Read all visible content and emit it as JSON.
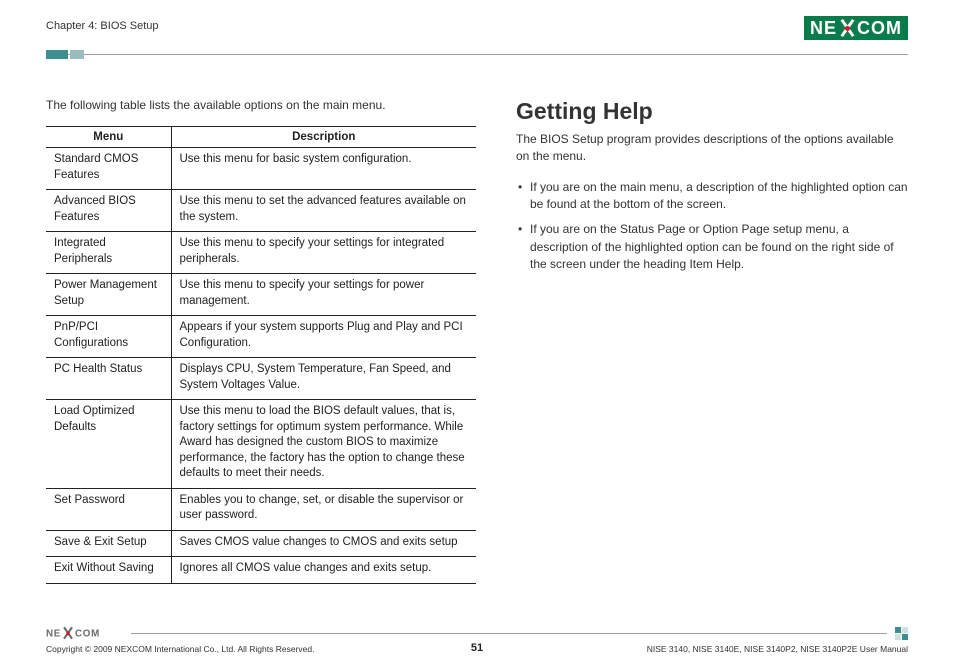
{
  "header": {
    "chapter": "Chapter 4: BIOS Setup",
    "logo_text_left": "NE",
    "logo_text_right": "COM"
  },
  "left": {
    "intro": "The following table lists the available options on the main menu.",
    "th_menu": "Menu",
    "th_desc": "Description",
    "rows": [
      {
        "menu": "Standard CMOS Features",
        "desc": "Use this menu for basic system configuration."
      },
      {
        "menu": "Advanced BIOS Features",
        "desc": "Use this menu to set the advanced features available on the system."
      },
      {
        "menu": "Integrated Peripherals",
        "desc": "Use this menu to specify your settings for integrated peripherals."
      },
      {
        "menu": "Power Management Setup",
        "desc": "Use this menu to specify your settings for power management."
      },
      {
        "menu": "PnP/PCI Configurations",
        "desc": "Appears if your system supports Plug and Play and PCI Configuration."
      },
      {
        "menu": "PC Health Status",
        "desc": "Displays CPU, System Temperature, Fan Speed, and System Voltages Value."
      },
      {
        "menu": "Load Optimized Defaults",
        "desc": "Use this menu to load the BIOS default values, that is, factory settings for optimum system performance. While Award has designed the custom BIOS to maximize performance, the factory has the option to change these defaults to meet their needs."
      },
      {
        "menu": "Set Password",
        "desc": "Enables you to change, set, or disable the supervisor or user password."
      },
      {
        "menu": "Save & Exit Setup",
        "desc": "Saves CMOS value changes to CMOS and exits setup"
      },
      {
        "menu": "Exit Without Saving",
        "desc": "Ignores all CMOS value changes and exits setup."
      }
    ]
  },
  "right": {
    "heading": "Getting Help",
    "para": "The BIOS Setup program provides descriptions of the options available on the menu.",
    "bullets": [
      "If you are on the main menu, a description of the highlighted option can be found at the bottom of the screen.",
      "If you are on the Status Page or Option Page setup menu, a description of the highlighted option can be found on the right side of the screen under the heading Item Help."
    ]
  },
  "footer": {
    "copyright": "Copyright © 2009 NEXCOM International Co., Ltd. All Rights Reserved.",
    "page": "51",
    "doc": "NISE 3140, NISE 3140E, NISE 3140P2, NISE 3140P2E User Manual"
  }
}
